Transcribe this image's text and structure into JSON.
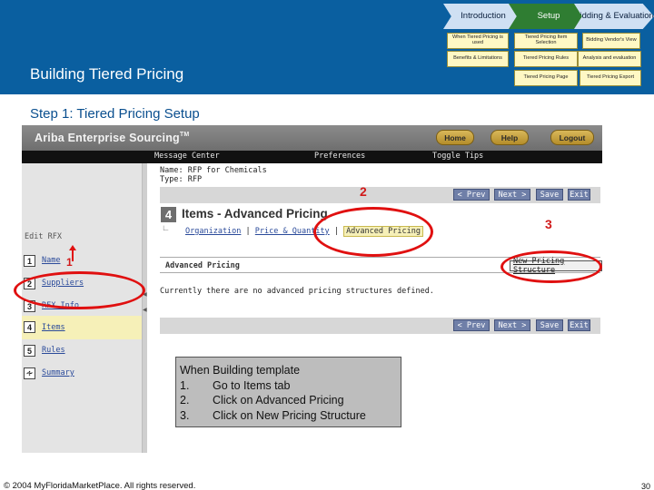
{
  "slide": {
    "title": "Building Tiered Pricing",
    "step_title": "Step 1: Tiered Pricing Setup",
    "copyright": "© 2004 MyFloridaMarketPlace. All rights reserved.",
    "page_number": "30"
  },
  "process": {
    "chevrons": [
      {
        "label": "Introduction",
        "active": false
      },
      {
        "label": "Setup",
        "active": true
      },
      {
        "label": "Bidding & Evaluation",
        "active": false
      }
    ],
    "sub_items": [
      "When Tiered Pricing is used",
      "Tiered Pricing Item Selection",
      "Bidding Vendor's View",
      "Benefits & Limitations",
      "Tiered Pricing Rules",
      "Analysis and evaluation",
      "Tiered Pricing Page",
      "Tiered Pricing Export"
    ]
  },
  "app": {
    "logo": "Ariba Enterprise Sourcing",
    "logo_tm": "TM",
    "top_buttons": [
      "Home",
      "Help",
      "Logout"
    ],
    "nav_items": [
      "Message Center",
      "Preferences",
      "Toggle Tips"
    ],
    "rfx_name_line": "Name: RFP for Chemicals",
    "rfx_type_line": "Type: RFP",
    "edit_rfx_label": "Edit RFX",
    "steps": [
      {
        "num": "1",
        "label": "Name"
      },
      {
        "num": "2",
        "label": "Suppliers"
      },
      {
        "num": "3",
        "label": "RFX Info"
      },
      {
        "num": "4",
        "label": "Items"
      },
      {
        "num": "5",
        "label": "Rules"
      },
      {
        "num": "",
        "label": "Summary"
      }
    ],
    "active_step": "Items",
    "action_buttons": [
      "< Prev",
      "Next >",
      "Save",
      "Exit"
    ],
    "page_step_num": "4",
    "page_title": "Items - Advanced Pricing",
    "tabs": [
      "Organization",
      "Price & Quantity",
      "Advanced Pricing"
    ],
    "tab_separator": "|",
    "selected_tab": "Advanced Pricing",
    "section_title": "Advanced Pricing",
    "new_structure_button": "New Pricing Structure",
    "empty_message": "Currently there are no advanced pricing structures defined."
  },
  "annotations": {
    "markers": [
      "1",
      "2",
      "3"
    ],
    "instructions_title": "When Building template",
    "instructions": [
      {
        "num": "1.",
        "text": "Go to Items tab"
      },
      {
        "num": "2.",
        "text": "Click on Advanced Pricing"
      },
      {
        "num": "3.",
        "text": "Click on New Pricing Structure"
      }
    ],
    "highlight_color": "#e01010"
  },
  "colors": {
    "header_band": "#0a5fa0",
    "step_title": "#0a4f8f",
    "setup_chevron": "#2f7d32",
    "sub_item_fill": "#fff8c4"
  }
}
